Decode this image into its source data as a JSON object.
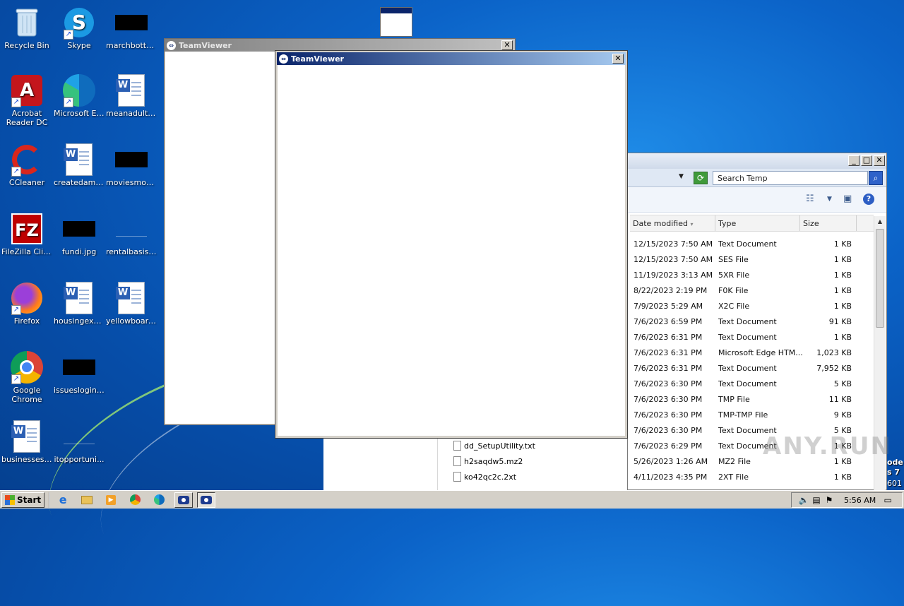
{
  "desktop_icons": [
    {
      "label": "Recycle Bin"
    },
    {
      "label": "Skype"
    },
    {
      "label": "marchbotto..."
    },
    {
      "label": "Acrobat Reader DC"
    },
    {
      "label": "Microsoft Edge"
    },
    {
      "label": "meanadult.rtf"
    },
    {
      "label": "CCleaner"
    },
    {
      "label": "createdam.rtf"
    },
    {
      "label": "moviesmont..."
    },
    {
      "label": "FileZilla Client"
    },
    {
      "label": "fundi.jpg"
    },
    {
      "label": "rentalbasis...."
    },
    {
      "label": "Firefox"
    },
    {
      "label": "housingexp..."
    },
    {
      "label": "yellowboard..."
    },
    {
      "label": "Google Chrome"
    },
    {
      "label": "issueslogin.jpg"
    },
    {
      "label": "businessesr..."
    },
    {
      "label": "itopportuni..."
    }
  ],
  "windows": {
    "back": {
      "title": "TeamViewer"
    },
    "front": {
      "title": "TeamViewer"
    }
  },
  "explorer": {
    "search_placeholder": "Search Temp",
    "columns": {
      "date": "Date modified",
      "type": "Type",
      "size": "Size"
    },
    "rows": [
      {
        "date": "12/15/2023 7:50 AM",
        "type": "Text Document",
        "size": "1 KB"
      },
      {
        "date": "12/15/2023 7:50 AM",
        "type": "SES File",
        "size": "1 KB"
      },
      {
        "date": "11/19/2023 3:13 AM",
        "type": "5XR File",
        "size": "1 KB"
      },
      {
        "date": "8/22/2023 2:19 PM",
        "type": "F0K File",
        "size": "1 KB"
      },
      {
        "date": "7/9/2023 5:29 AM",
        "type": "X2C File",
        "size": "1 KB"
      },
      {
        "date": "7/6/2023 6:59 PM",
        "type": "Text Document",
        "size": "91 KB"
      },
      {
        "date": "7/6/2023 6:31 PM",
        "type": "Text Document",
        "size": "1 KB"
      },
      {
        "date": "7/6/2023 6:31 PM",
        "type": "Microsoft Edge HTM...",
        "size": "1,023 KB"
      },
      {
        "date": "7/6/2023 6:31 PM",
        "type": "Text Document",
        "size": "7,952 KB"
      },
      {
        "date": "7/6/2023 6:30 PM",
        "type": "Text Document",
        "size": "5 KB"
      },
      {
        "date": "7/6/2023 6:30 PM",
        "type": "TMP File",
        "size": "11 KB"
      },
      {
        "date": "7/6/2023 6:30 PM",
        "type": "TMP-TMP File",
        "size": "9 KB"
      },
      {
        "date": "7/6/2023 6:30 PM",
        "type": "Text Document",
        "size": "5 KB"
      },
      {
        "date": "7/6/2023 6:29 PM",
        "type": "Text Document",
        "size": "1 KB"
      },
      {
        "date": "5/26/2023 1:26 AM",
        "type": "MZ2 File",
        "size": "1 KB"
      },
      {
        "date": "4/11/2023 4:35 PM",
        "type": "2XT File",
        "size": "1 KB"
      }
    ],
    "names": [
      {
        "name": "dd_SetupUtility.txt"
      },
      {
        "name": "h2saqdw5.mz2"
      },
      {
        "name": "ko42qc2c.2xt"
      }
    ]
  },
  "taskbar": {
    "start_label": "Start",
    "clock": "5:56 AM"
  },
  "side_text": [
    "ode",
    "s 7",
    "601"
  ],
  "watermark": "ANY.RUN"
}
